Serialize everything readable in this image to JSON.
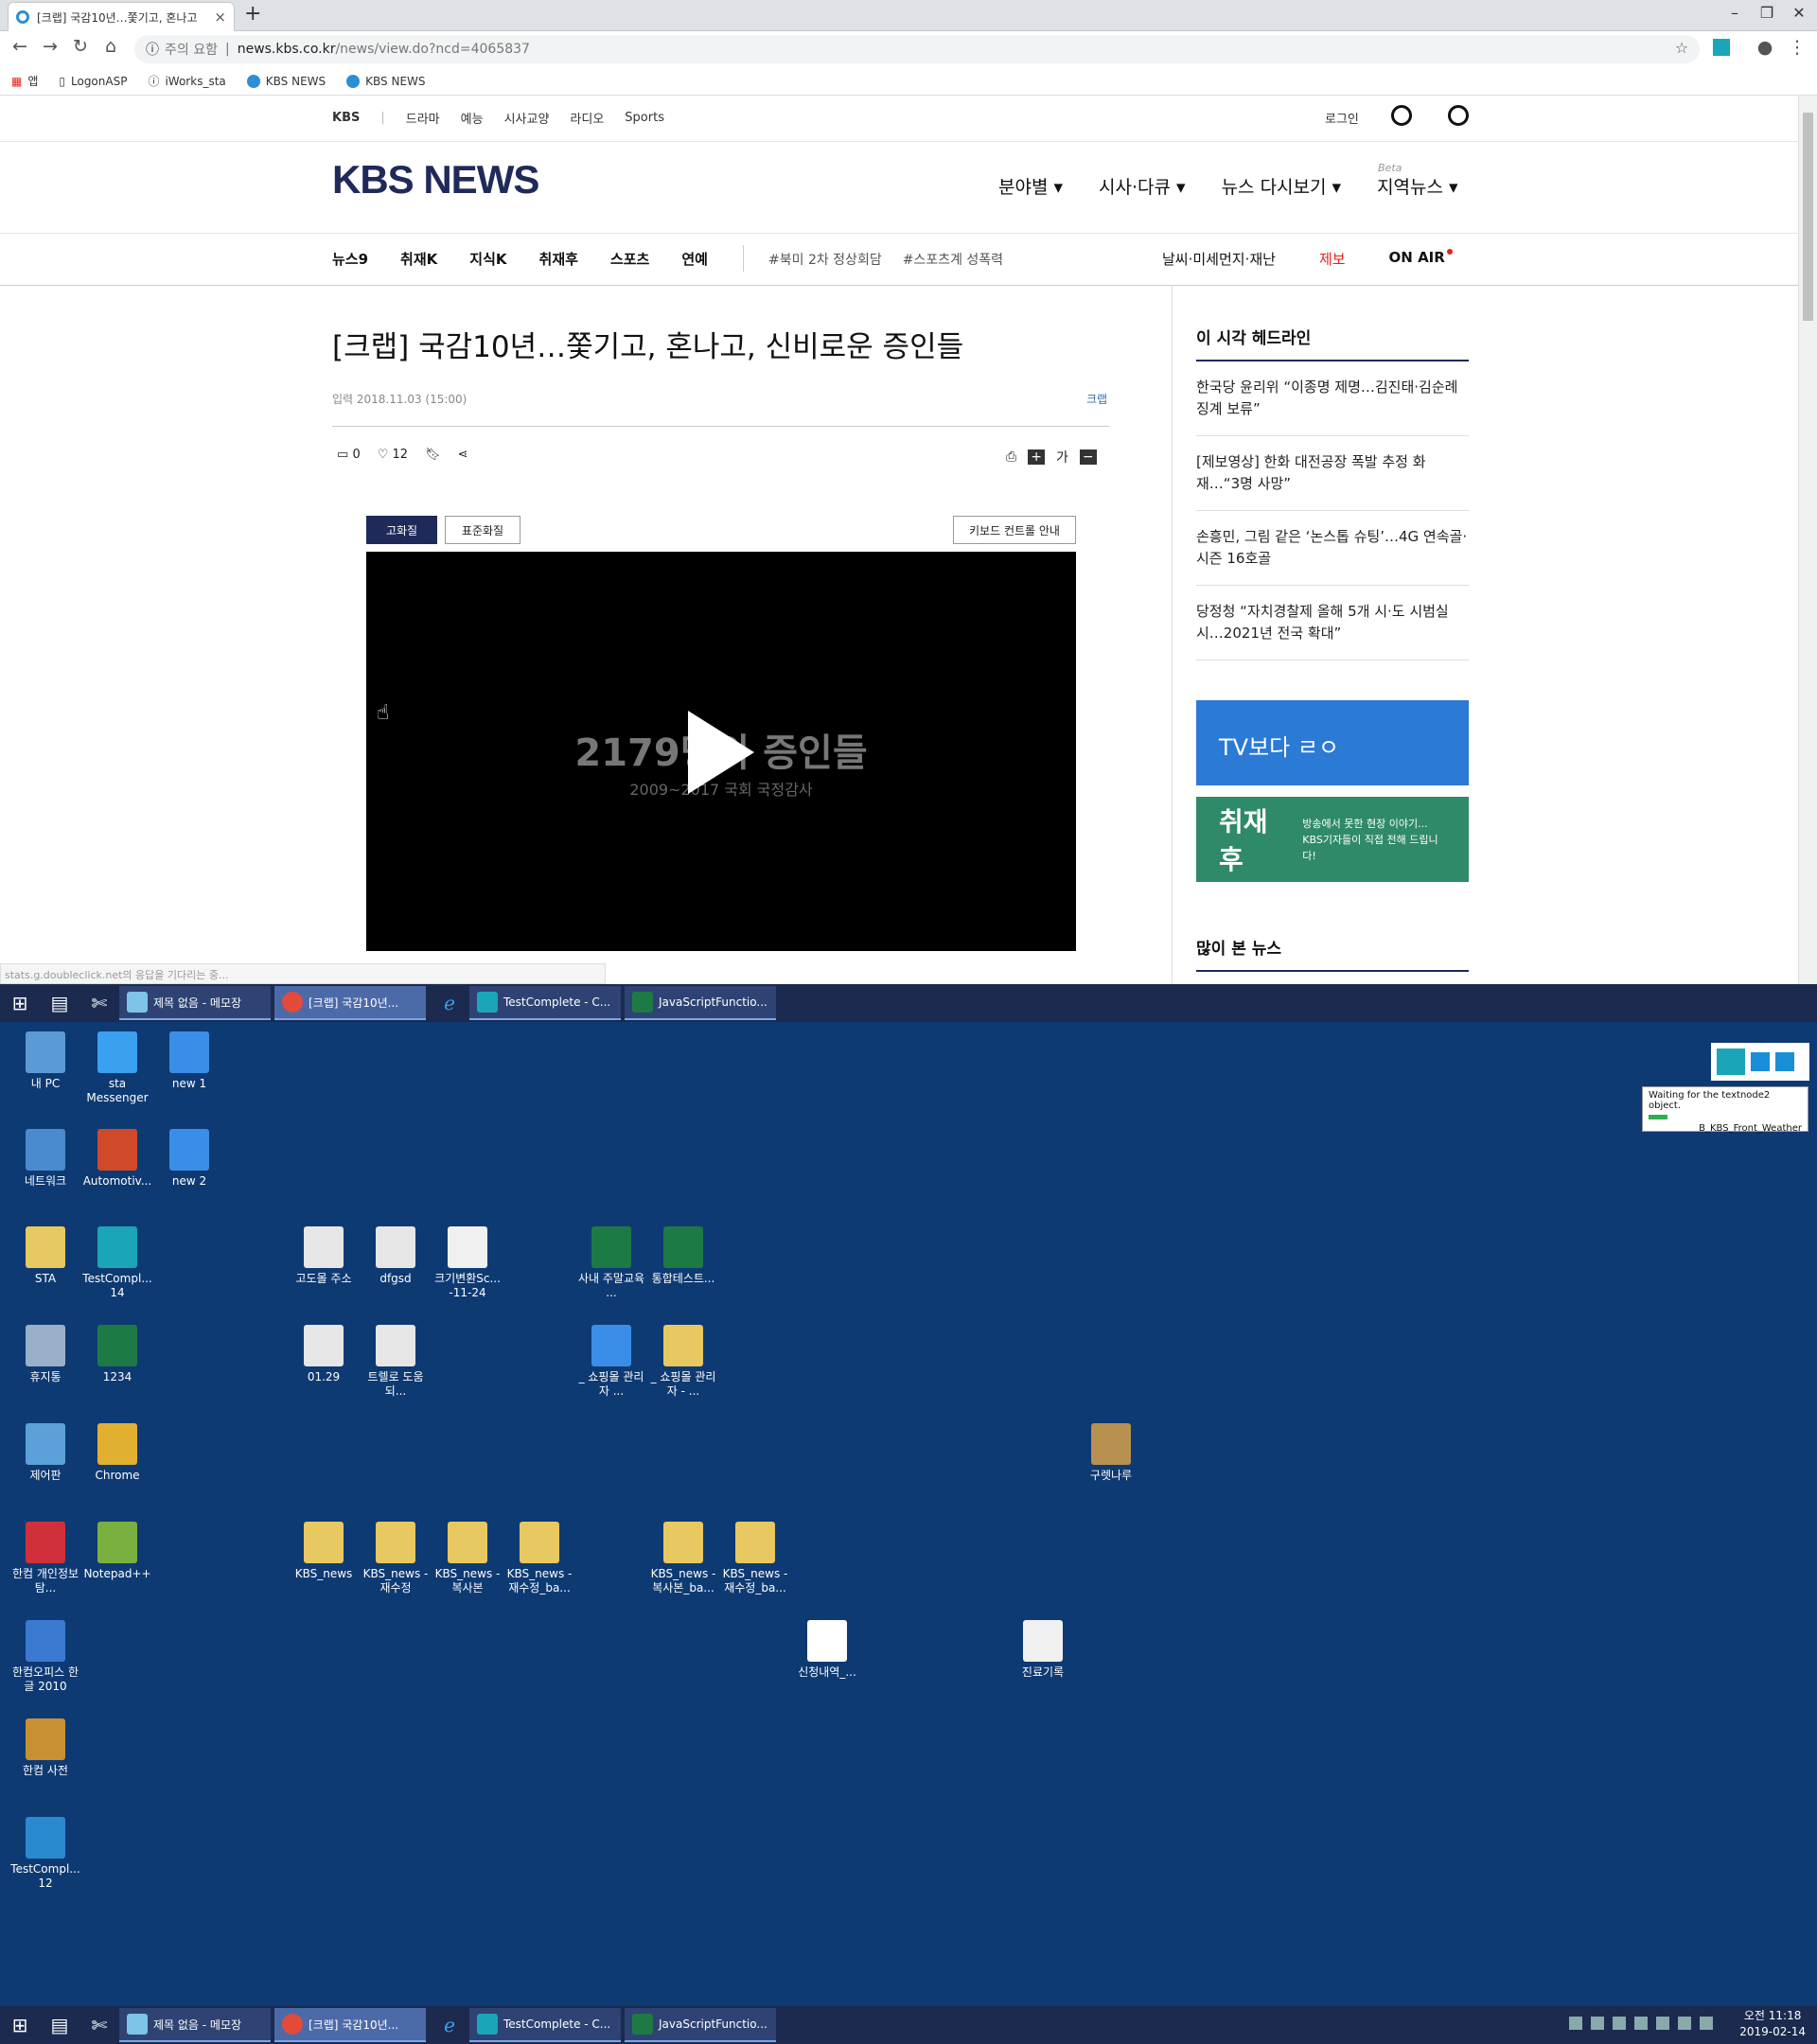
{
  "browser": {
    "tab_title": "[크랩] 국감10년…쫓기고, 혼나고",
    "security_label": "주의 요함",
    "url_domain": "news.kbs.co.kr",
    "url_path": "/news/view.do?ncd=4065837",
    "bookmarks": [
      "앱",
      "LogonASP",
      "iWorks_sta",
      "KBS NEWS",
      "KBS NEWS"
    ],
    "status_text": "stats.g.doubleclick.net의 응답을 기다리는 중..."
  },
  "site": {
    "gnb": [
      "KBS",
      "드라마",
      "예능",
      "시사교양",
      "라디오",
      "Sports"
    ],
    "login": "로그인",
    "logo": "KBS NEWS",
    "main_nav": [
      "분야별 ▾",
      "시사·다큐 ▾",
      "뉴스 다시보기 ▾",
      "지역뉴스 ▾"
    ],
    "beta": "Beta",
    "sub_nav": [
      "뉴스9",
      "취재K",
      "지식K",
      "취재후",
      "스포츠",
      "연예"
    ],
    "hashtags": [
      "#북미 2차 정상회담",
      "#스포츠계 성폭력"
    ],
    "right_nav": {
      "weather": "날씨·미세먼지·재난",
      "tip": "제보",
      "onair": "ON AIR"
    }
  },
  "article": {
    "headline": "[크랩] 국감10년…쫓기고, 혼나고, 신비로운 증인들",
    "date": "입력 2018.11.03 (15:00)",
    "category": "크랩",
    "comments": "0",
    "likes": "12",
    "font_label": "가",
    "btn_hq": "고화질",
    "btn_sd": "표준화질",
    "btn_keyboard": "키보드 컨트롤 안내",
    "video_title": "2179명의 증인들",
    "video_sub": "2009~2017 국회 국정감사"
  },
  "sidebar": {
    "headline_title": "이 시각 헤드라인",
    "headlines": [
      "한국당 윤리위 “이종명 제명…김진태·김순례 징계 보류”",
      "[제보영상] 한화 대전공장 폭발 추정 화재…“3명 사망”",
      "손흥민, 그림 같은 ‘논스톱 슈팅’…4G 연속골·시즌 16호골",
      "당정청 “자치경찰제 올해 5개 시·도 시범실시…2021년 전국 확대”"
    ],
    "banner1": "TV보다 ㄹㅇ",
    "banner2_big": "취재후",
    "banner2_small1": "방송에서 못한 현장 이야기...",
    "banner2_small2": "KBS기자들이 직접 전해 드립니다!",
    "popular_title": "많이 본 뉴스"
  },
  "taskbar": {
    "items": [
      "제목 없음 - 메모장",
      "[크랩] 국감10년...",
      "TestComplete - C...",
      "JavaScriptFunctio..."
    ],
    "time": "오전 11:18",
    "date": "2019-02-14"
  },
  "testcomplete": {
    "msg": "Waiting for the textnode2 object.",
    "test": "B_KBS_Front_Weather"
  },
  "desktop": {
    "icons": [
      "내 PC",
      "sta Messenger",
      "new 1",
      "네트워크",
      "Automotiv...",
      "new 2",
      "STA",
      "TestCompl... 14",
      "휴지통",
      "1234",
      "제어판",
      "Chrome",
      "한컴 개인정보탐...",
      "Notepad++",
      "한컴오피스 한글 2010",
      "한컴 사전",
      "TestCompl... 12",
      "고도몰 주소",
      "dfgsd",
      "크기변환Sc... -11-24",
      "사내 주말교육 ...",
      "통합테스트...",
      "01.29",
      "트렐로 도움되...",
      "_ 쇼핑몰 관리자 ...",
      "_ 쇼핑몰 관리자 - ...",
      "구렛나루",
      "KBS_news",
      "KBS_news - 재수정",
      "KBS_news - 복사본",
      "KBS_news - 재수정_ba...",
      "KBS_news - 복사본_ba...",
      "KBS_news - 재수정_ba...",
      "신청내역_...",
      "진료기록"
    ]
  }
}
